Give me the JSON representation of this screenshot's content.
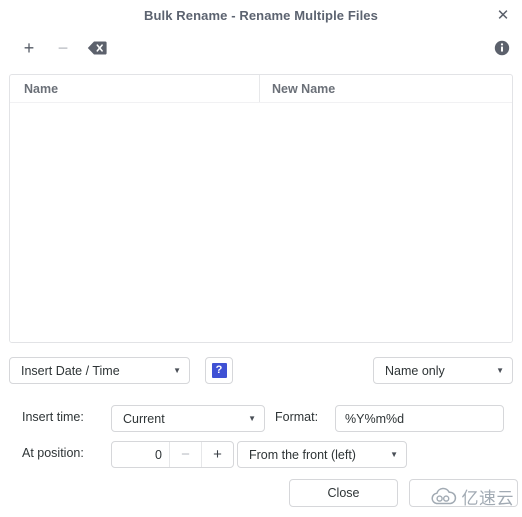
{
  "window": {
    "title": "Bulk Rename - Rename Multiple Files",
    "close_label": "✕",
    "close_icon": "close-icon"
  },
  "toolbar": {
    "add_label": "+",
    "add_icon": "plus-icon",
    "remove_label": "−",
    "remove_icon": "minus-icon",
    "clear_icon": "clear-all-backspace-icon",
    "info_icon": "info-icon"
  },
  "file_list": {
    "columns": [
      {
        "label": "Name"
      },
      {
        "label": "New Name"
      }
    ],
    "rows": []
  },
  "controls": {
    "mode": {
      "value": "Insert Date / Time",
      "arrow": "▼"
    },
    "help": {
      "label": "?",
      "icon": "help-question-icon",
      "color": "#3f51d4"
    },
    "scope": {
      "value": "Name only",
      "arrow": "▼"
    },
    "insert_time": {
      "label": "Insert time:",
      "value": "Current",
      "arrow": "▼"
    },
    "format": {
      "label": "Format:",
      "value": "%Y%m%d",
      "placeholder": "%Y%m%d"
    },
    "at_position": {
      "label": "At position:",
      "value": "0",
      "decrement_label": "−",
      "increment_label": "+",
      "direction_value": "From the front (left)",
      "arrow": "▼"
    }
  },
  "footer": {
    "close_label": "Close",
    "apply_label": ""
  },
  "watermark": {
    "text": "亿速云",
    "icon": "cloud-logo-icon"
  }
}
